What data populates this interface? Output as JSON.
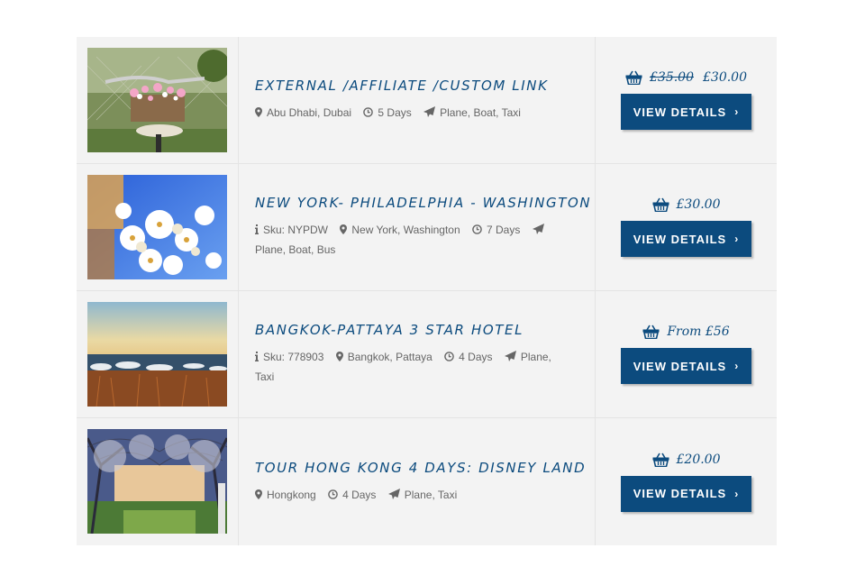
{
  "colors": {
    "accent": "#0c4b7e",
    "row_bg": "#f3f3f3",
    "meta_text": "#666666"
  },
  "tours": [
    {
      "title": "External /affiliate /custom link",
      "sku": null,
      "location": "Abu Dhabi, Dubai",
      "duration": "5 Days",
      "transport": "Plane, Boat, Taxi",
      "old_price": "£35.00",
      "price": "£30.00",
      "button": "VIEW DETAILS",
      "image": "bicycle-flower-basket"
    },
    {
      "title": "New York- Philadelphia - Washington",
      "sku": "Sku: NYPDW",
      "location": "New York, Washington",
      "duration": "7 Days",
      "transport": "Plane, Boat, Bus",
      "old_price": null,
      "price": "£30.00",
      "button": "VIEW DETAILS",
      "image": "white-blossoms"
    },
    {
      "title": "Bangkok-Pattaya 3 star hotel",
      "sku": "Sku: 778903",
      "location": "Bangkok, Pattaya",
      "duration": "4 Days",
      "transport": "Plane, Taxi",
      "old_price": null,
      "price": "From £56",
      "button": "VIEW DETAILS",
      "image": "frozen-lake-shore"
    },
    {
      "title": "Tour Hong Kong 4 days: Disney Land",
      "sku": null,
      "location": "Hongkong",
      "duration": "4 Days",
      "transport": "Plane, Taxi",
      "old_price": null,
      "price": "£20.00",
      "button": "VIEW DETAILS",
      "image": "tree-avenue"
    }
  ]
}
